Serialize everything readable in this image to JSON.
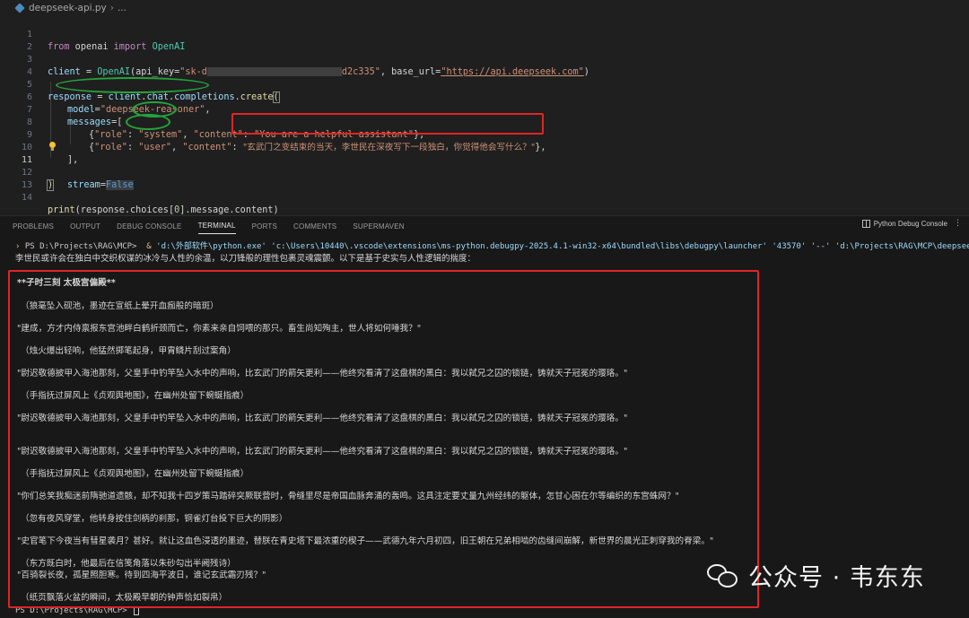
{
  "breadcrumb": {
    "file": "deepseek-api.py",
    "rest": "..."
  },
  "code": {
    "l1": [
      "from",
      " openai ",
      "import",
      " OpenAI"
    ],
    "l3_client": "client",
    "l3_eq": " = ",
    "l3_cls": "OpenAI",
    "l3_p1": "(api_key=",
    "l3_key_start": "\"sk-d",
    "l3_key_end": "d2c335\"",
    "l3_p2": ", base_url=",
    "l3_url": "\"https://api.deepseek.com\"",
    "l3_p3": ")",
    "l5": [
      "response",
      " = ",
      "client",
      ".",
      "chat",
      ".",
      "completions",
      ".",
      "create",
      "("
    ],
    "l6": [
      "model",
      "=",
      "\"deepseek-reasoner\"",
      ","
    ],
    "l7": [
      "messages",
      "=["
    ],
    "l8": [
      "{",
      "\"role\"",
      ": ",
      "\"system\"",
      ", ",
      "\"content\"",
      ": ",
      "\"You are a helpful assistant\"",
      "},"
    ],
    "l9": [
      "{",
      "\"role\"",
      ": ",
      "\"user\"",
      ", ",
      "\"content\"",
      ": ",
      "\"玄武门之变结束的当天，李世民在深夜写下一段独白，你觉得他会写什么？\"",
      "},"
    ],
    "l10": "],",
    "l11": [
      "stream",
      "=",
      "False"
    ],
    "l12": ")",
    "l14": [
      "print",
      "(response.choices[",
      "0",
      "].message.content)"
    ],
    "line_numbers": [
      "1",
      "2",
      "3",
      "4",
      "5",
      "6",
      "7",
      "8",
      "9",
      "10",
      "11",
      "12",
      "13",
      "14"
    ]
  },
  "panel": {
    "tabs": [
      "PROBLEMS",
      "OUTPUT",
      "DEBUG CONSOLE",
      "TERMINAL",
      "PORTS",
      "COMMENTS",
      "SUPERMAVEN"
    ],
    "active_tab": "TERMINAL",
    "debug_console": "Python Debug Console"
  },
  "terminal": {
    "cmd_prefix": "PS D:\\Projects\\RAG\\MCP> ",
    "cmd_amp": " & ",
    "cmd_body": "'d:\\外部软件\\python.exe' 'c:\\Users\\10440\\.vscode\\extensions\\ms-python.debugpy-2025.4.1-win32-x64\\bundled\\libs\\debugpy\\launcher' '43570' '--' 'd:\\Projects\\RAG\\MCP\\deepseek-api.py'",
    "intro": "李世民或许会在独白中交织权谋的冰冷与人性的余温，以刀锋般的理性包裹灵魂震颤。以下是基于史实与人性逻辑的揣度：",
    "lines": [
      "**子时三刻 太极宫偏殿**",
      "（狼毫坠入砚池，墨迹在宣纸上晕开血痂般的暗斑）",
      "\"建成，方才内侍禀报东宫池畔白鹤折颈而亡，你素来亲自饲喂的那只。畜生尚知殉主，世人将如何唾我？\"",
      "（烛火爆出轻响，他猛然掷笔起身，甲胄鳞片刮过案角）",
      "\"尉迟敬德披甲入海池那刻，父皇手中钓竿坠入水中的声响，比玄武门的箭矢更利——他终究看清了这盘棋的黑白：我以弑兄之囚的锁链，铸就天子冠冕的璎珞。\"",
      "（手指抚过屏风上《贞观舆地图》，在幽州处留下蜿蜒指痕）",
      "\"尉迟敬德披甲入海池那刻，父皇手中钓竿坠入水中的声响，比玄武门的箭矢更利——他终究看清了这盘棋的黑白：我以弑兄之囚的锁链，铸就天子冠冕的璎珞。\"",
      "\"尉迟敬德披甲入海池那刻，父皇手中钓竿坠入水中的声响，比玄武门的箭矢更利——他终究看清了这盘棋的黑白：我以弑兄之囚的锁链，铸就天子冠冕的璎珞。\"",
      "（手指抚过屏风上《贞观舆地图》，在幽州处留下蜿蜒指痕）",
      "\"你们总笑我痴迷前隋驰道遗骸，却不知我十四岁策马踏碎突厥联营时，骨缝里尽是帝国血脉奔涌的轰鸣。这具注定要丈量九州经纬的躯体，怎甘心困在尔等编织的东宫蛛网？\"",
      "（忽有夜风穿堂，他转身按住剑柄的刹那，铜雀灯台投下巨大的阴影）",
      "\"史官笔下今夜当有彗星袭月？甚好。就让这血色浸透的墨迹，替朕在青史塔下最浓重的楔子——武德九年六月初四，旧王朝在兄弟相啮的齿缝间崩解，新世界的晨光正刺穿我的脊梁。\"",
      "（东方既白时，他最后在信笺角落以朱砂勾出半阙残诗）",
      "\"百骑裂长夜，孤星照胆寒。待到四海平波日，谁记玄武霜刃残？\"",
      "（纸页飘落火盆的瞬间，太极殿早朝的钟声恰如裂帛）"
    ],
    "final_prompt": "PS D:\\Projects\\RAG\\MCP> "
  },
  "watermark": {
    "text": "公众号 · 韦东东"
  },
  "colors": {
    "annotation_red": "#e02525",
    "annotation_green": "#26a33a"
  }
}
